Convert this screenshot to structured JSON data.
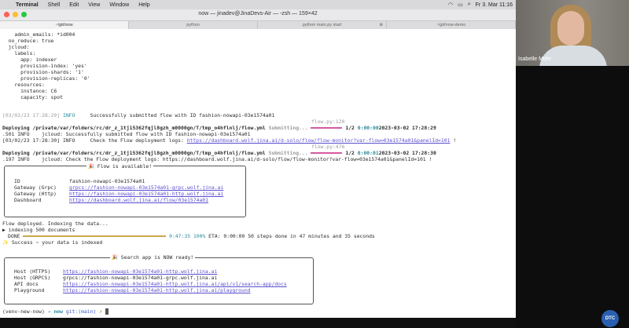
{
  "menubar": {
    "apple": "",
    "app": "Terminal",
    "items": [
      "Shell",
      "Edit",
      "View",
      "Window",
      "Help"
    ],
    "clock": "Fr 3. Mar 11:16"
  },
  "window": {
    "title": "now — jinadev@JinaDevs-Air — -zsh — 159×42",
    "tabs": [
      "~/git/now",
      "python",
      "python main.py start",
      "~/git/now-demo"
    ]
  },
  "terminal": {
    "lines": [
      "    admin_emails: *id004",
      "  no_reduce: true",
      "  jcloud:",
      "    labels:",
      "      app: indexer",
      "      provision-index: 'yes'",
      "      provision-shards: '1'",
      "      provision-replicas: '0'",
      "    resources:",
      "      instance: C6",
      "      capacity: spot"
    ],
    "info1": {
      "ts": "[03/02/23 17:28:29]",
      "level": "INFO",
      "msg": "Successfully submitted flow with ID fashion-nowapi-03e1574a01"
    },
    "flowpy1": "flow.py:120",
    "deploy1": {
      "prefix": "Deploying /private/var/folders/rc/dr_z_1tj15362fqjl8gzh_m0000gn/T/tmp_o4hflnlj/flow.yml",
      "submitting": "Submitting...",
      "count": "1/2",
      "time": "0:00:00",
      "stamp": "2023-03-02 17:28:29"
    },
    "line_501": ".501 INFO    jcloud: Successfully submitted flow with ID fashion-nowapi-03e1574a01",
    "line_info2_a": "[03/02/23 17:28:30] INFO     Check the Flow deployment logs: ",
    "line_info2_link": "https://dashboard.wolf.jina.ai/d-solo/flow/flow-monitor?var-flow=03e1574a01&panelId=101",
    "line_info2_b": " !",
    "flowpy2": "flow.py:476",
    "deploy2": {
      "prefix": "Deploying /private/var/folders/rc/dr_z_1tj15362fqjl8gzh_m0000gn/T/tmp_o4hflnlj/flow.yml",
      "submitting": "Submitting...",
      "count": "1/2",
      "time": "0:00:01",
      "stamp": "2023-03-02 17:28:30"
    },
    "line_197": ".197 INFO    jcloud: Check the Flow deployment logs: https://dashboard.wolf.jina.ai/d-solo/flow/flow-monitor?var-flow=03e1574a01&panelId=101 !",
    "flow_box": {
      "title": "🎉 Flow is available!",
      "rows": [
        {
          "label": "ID",
          "value": "fashion-nowapi-03e1574a01",
          "is_link": false
        },
        {
          "label": "Gateway (Grpc)",
          "value": "grpcs://fashion-nowapi-03e1574a01-grpc.wolf.jina.ai",
          "is_link": true
        },
        {
          "label": "Gateway (Http)",
          "value": "https://fashion-nowapi-03e1574a01-http.wolf.jina.ai",
          "is_link": true
        },
        {
          "label": "Dashboard",
          "value": "https://dashboard.wolf.jina.ai/flow/03e1574a01",
          "is_link": true
        }
      ]
    },
    "deployed_line": "Flow deployed. Indexing the data...",
    "indexing_line": "▶ indexing 500 documents",
    "done": {
      "label": "DONE",
      "elapsed": "0:47:35",
      "percent": "100%",
      "eta": "ETA: 0:00:00",
      "summary": "50 steps done in 47 minutes and 35 seconds"
    },
    "success_line": "Success ~ your data is indexed",
    "search_box": {
      "title": "🎉 Search app is NOW ready!",
      "rows": [
        {
          "label": "Host (HTTPS)",
          "value": "https://fashion-nowapi-03e1574a01-http.wolf.jina.ai"
        },
        {
          "label": "Host (GRPCS)",
          "value": "grpcs://fashion-nowapi-03e1574a01-grpc.wolf.jina.ai"
        },
        {
          "label": "API docs",
          "value": "https://fashion-nowapi-03e1574a01-http.wolf.jina.ai/api/v1/search-app/docs"
        },
        {
          "label": "Playground",
          "value": "https://fashion-nowapi-03e1574a01-http.wolf.jina.ai/playground"
        }
      ]
    },
    "prompt": {
      "venv": "(venv-new-now)",
      "arrow": "→",
      "dir": "now",
      "git": "git:(main)",
      "x": "✗"
    }
  },
  "participant": {
    "name": "Isabelle Mohr"
  },
  "logo": {
    "text": "DTC"
  },
  "colors": {
    "link": "#5a4fcf",
    "progress": "#d45aa0",
    "done_bar": "#c9a84a"
  }
}
